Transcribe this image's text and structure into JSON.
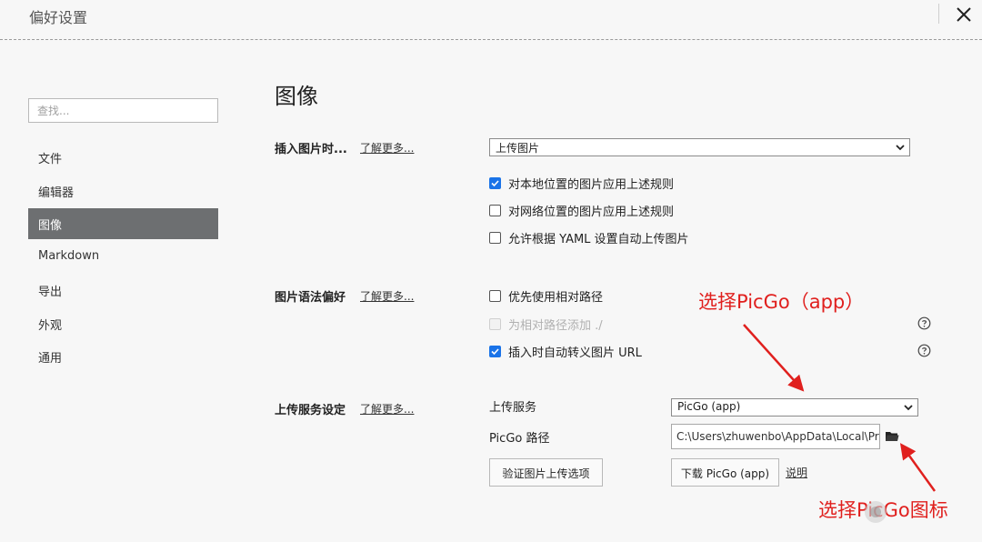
{
  "window": {
    "title": "偏好设置"
  },
  "sidebar": {
    "search_placeholder": "查找...",
    "items": [
      {
        "label": "文件"
      },
      {
        "label": "编辑器"
      },
      {
        "label": "图像",
        "active": true
      },
      {
        "label": "Markdown"
      },
      {
        "label": "导出"
      },
      {
        "label": "外观"
      },
      {
        "label": "通用"
      }
    ]
  },
  "main": {
    "title": "图像",
    "insert_image": {
      "label": "插入图片时...",
      "learn_more": "了解更多...",
      "select_value": "上传图片",
      "options": [
        {
          "label": "对本地位置的图片应用上述规则",
          "checked": true
        },
        {
          "label": "对网络位置的图片应用上述规则",
          "checked": false
        },
        {
          "label": "允许根据 YAML 设置自动上传图片",
          "checked": false
        }
      ]
    },
    "syntax_pref": {
      "label": "图片语法偏好",
      "learn_more": "了解更多...",
      "options": [
        {
          "label": "优先使用相对路径",
          "checked": false
        },
        {
          "label": "为相对路径添加 ./",
          "checked": false,
          "disabled": true
        },
        {
          "label": "插入时自动转义图片 URL",
          "checked": true
        }
      ]
    },
    "upload_service": {
      "label": "上传服务设定",
      "learn_more": "了解更多...",
      "service_label": "上传服务",
      "service_value": "PicGo (app)",
      "path_label": "PicGo 路径",
      "path_value": "C:\\Users\\zhuwenbo\\AppData\\Local\\Programs\\PicGo\\PicGo.exe",
      "verify_button": "验证图片上传选项",
      "download_button": "下载 PicGo (app)",
      "help_link": "说明"
    }
  },
  "annotations": {
    "choose_picgo_app": "选择PicGo（app）",
    "choose_picgo_icon": "选择PicGo图标",
    "color": "#e0201e"
  },
  "icons": {
    "close": "close-icon",
    "chevron": "chevron-down-icon",
    "help": "question-circle-icon",
    "folder": "folder-icon",
    "check": "check-icon"
  }
}
